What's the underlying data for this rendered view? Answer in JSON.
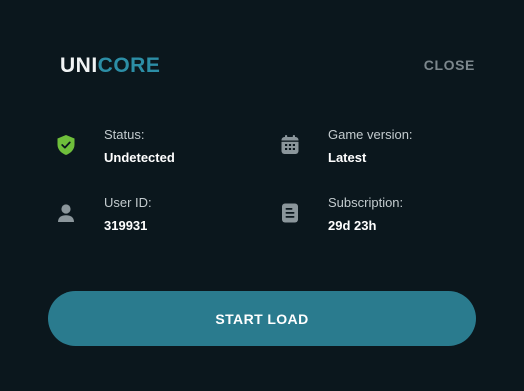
{
  "app": {
    "logo_part1": "UNI",
    "logo_part2": "CORE",
    "close_label": "CLOSE"
  },
  "info": {
    "status": {
      "label": "Status:",
      "value": "Undetected",
      "icon": "shield-check-icon"
    },
    "game_version": {
      "label": "Game version:",
      "value": "Latest",
      "icon": "calendar-icon"
    },
    "user_id": {
      "label": "User ID:",
      "value": "319931",
      "icon": "user-icon"
    },
    "subscription": {
      "label": "Subscription:",
      "value": "29d 23h",
      "icon": "document-icon"
    }
  },
  "actions": {
    "start_label": "START LOAD"
  },
  "colors": {
    "background": "#0b171d",
    "accent": "#2c8ea6",
    "button": "#2a7b8e",
    "status_ok": "#6fbf3b"
  }
}
